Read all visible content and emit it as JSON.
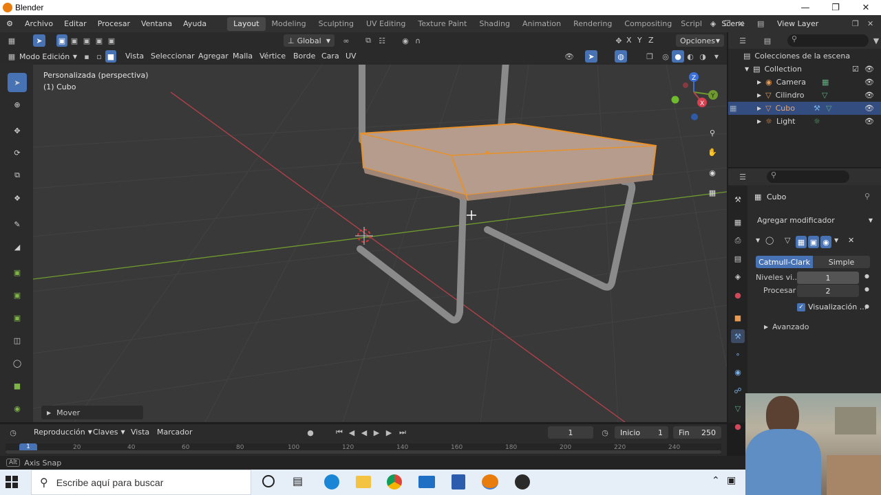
{
  "window": {
    "title": "Blender"
  },
  "menu": {
    "items": [
      "Archivo",
      "Editar",
      "Procesar",
      "Ventana",
      "Ayuda"
    ],
    "workspaces": [
      "Layout",
      "Modeling",
      "Sculpting",
      "UV Editing",
      "Texture Paint",
      "Shading",
      "Animation",
      "Rendering",
      "Compositing",
      "Scripl"
    ],
    "scene": "Scene",
    "view_layer": "View Layer"
  },
  "viewport_header": {
    "transform_orientation": "Global",
    "options": "Opciones",
    "mode": "Modo Edición",
    "menus": [
      "Vista",
      "Seleccionar",
      "Agregar",
      "Malla",
      "Vértice",
      "Borde",
      "Cara",
      "UV"
    ],
    "axes": [
      "X",
      "Y",
      "Z"
    ]
  },
  "viewport": {
    "view_name": "Personalizada (perspectiva)",
    "object_label": "(1) Cubo",
    "last_operator": "Mover",
    "gizmo_labels": [
      "Z",
      "Y",
      "X"
    ]
  },
  "outliner": {
    "title": "Colecciones de la escena",
    "collection": "Collection",
    "items": [
      {
        "name": "Camera",
        "icon": "camera-icon",
        "selected": false
      },
      {
        "name": "Cilindro",
        "icon": "mesh-icon",
        "selected": false
      },
      {
        "name": "Cubo",
        "icon": "mesh-icon",
        "selected": true
      },
      {
        "name": "Light",
        "icon": "light-icon",
        "selected": false
      }
    ]
  },
  "properties": {
    "object_name": "Cubo",
    "add_modifier": "Agregar modificador",
    "subdiv_types": [
      "Catmull-Clark",
      "Simple"
    ],
    "levels_viewport_label": "Niveles vi...",
    "levels_viewport_value": "1",
    "render_label": "Procesar",
    "render_value": "2",
    "optimal_display_label": "Visualización ...",
    "advanced_label": "Avanzado"
  },
  "timeline": {
    "playback": "Reproducción",
    "keys": "Claves",
    "view": "Vista",
    "marker": "Marcador",
    "current_frame": "1",
    "start_label": "Inicio",
    "start_value": "1",
    "end_label": "Fin",
    "end_value": "250",
    "ruler": [
      "1",
      "20",
      "40",
      "60",
      "80",
      "100",
      "120",
      "140",
      "160",
      "180",
      "200",
      "220",
      "240"
    ]
  },
  "status": {
    "key": "Alt",
    "hint": "Axis Snap"
  },
  "taskbar": {
    "search_placeholder": "Escribe aquí para buscar"
  },
  "colors": {
    "accent": "#4772b3",
    "selection_orange": "#e8912a",
    "viewport_bg": "#393939",
    "x_axis": "#b8404a",
    "y_axis": "#6f9a2e"
  }
}
